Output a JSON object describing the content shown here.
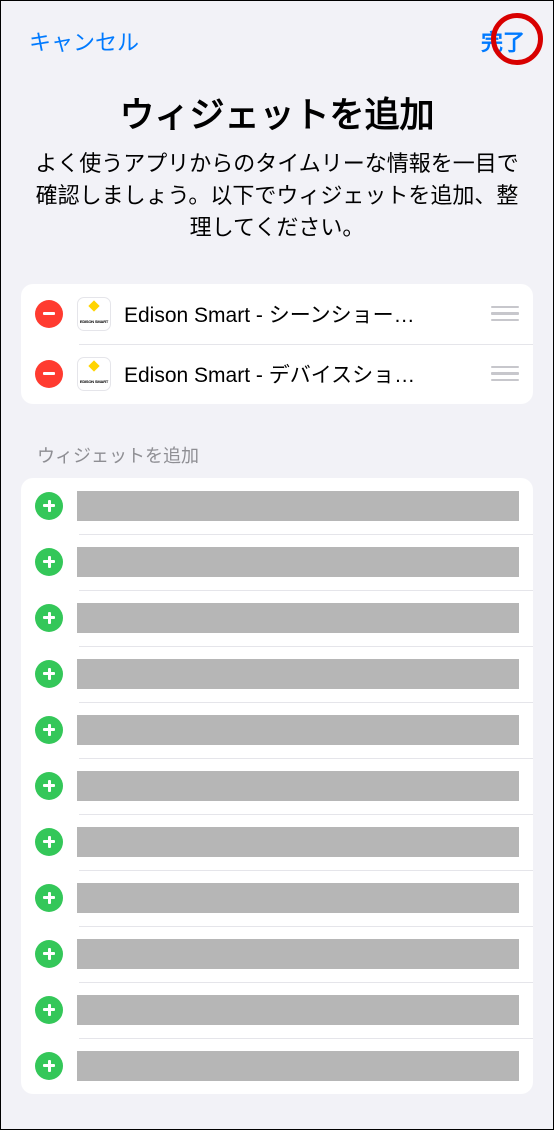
{
  "header": {
    "cancel_label": "キャンセル",
    "done_label": "完了"
  },
  "title": "ウィジェットを追加",
  "subtitle": "よく使うアプリからのタイムリーな情報を一目で確認しましょう。以下でウィジェットを追加、整理してください。",
  "active_widgets": [
    {
      "label": "Edison Smart - シーンショー…",
      "app": "Edison Smart"
    },
    {
      "label": "Edison Smart - デバイスショ…",
      "app": "Edison Smart"
    }
  ],
  "section_header": "ウィジェットを追加",
  "available_widgets_count": 11
}
